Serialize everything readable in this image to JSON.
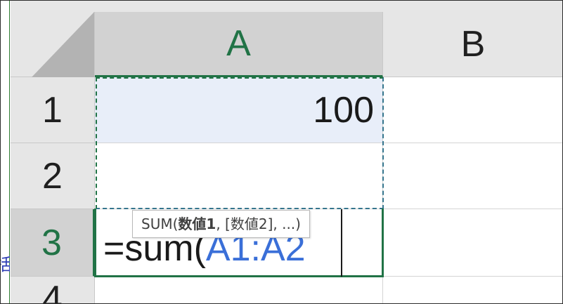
{
  "sheet": {
    "columns": [
      {
        "label": "A",
        "selected": true
      },
      {
        "label": "B",
        "selected": false
      }
    ],
    "rows": [
      {
        "label": "1",
        "selected": false
      },
      {
        "label": "2",
        "selected": false
      },
      {
        "label": "3",
        "selected": true
      },
      {
        "label": "4",
        "selected": false
      }
    ],
    "cells": {
      "A1": "100",
      "A2": "",
      "B1": "",
      "B2": "",
      "B3": "",
      "A4": "",
      "B4": ""
    },
    "active_cell": "A3"
  },
  "editor": {
    "prefix": "=sum(",
    "range_ref": "A1:A2"
  },
  "tooltip": {
    "func": "SUM(",
    "arg1": "数値1",
    "rest": ", [数値2], ...)"
  },
  "left_sliver": {
    "glyph": "括"
  },
  "colors": {
    "accent_green": "#217346",
    "reference_blue": "#3a6fd8",
    "header_gray": "#e6e6e6",
    "selected_header_gray": "#d2d2d2",
    "range_fill": "#e8eef9"
  }
}
